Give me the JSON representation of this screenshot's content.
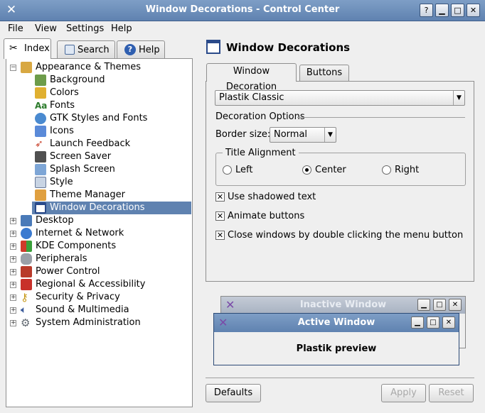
{
  "window": {
    "title": "Window Decorations - Control Center"
  },
  "menubar": {
    "file": "File",
    "view": "View",
    "settings": "Settings",
    "help": "Help"
  },
  "left_tabs": {
    "index": "Index",
    "search": "Search",
    "help": "Help"
  },
  "tree": {
    "appearance": "Appearance & Themes",
    "children": [
      "Background",
      "Colors",
      "Fonts",
      "GTK Styles and Fonts",
      "Icons",
      "Launch Feedback",
      "Screen Saver",
      "Splash Screen",
      "Style",
      "Theme Manager",
      "Window Decorations"
    ],
    "categories": [
      "Desktop",
      "Internet & Network",
      "KDE Components",
      "Peripherals",
      "Power Control",
      "Regional & Accessibility",
      "Security & Privacy",
      "Sound & Multimedia",
      "System Administration"
    ],
    "selected": "Window Decorations"
  },
  "panel": {
    "title": "Window Decorations",
    "tab_decoration": "Window Decoration",
    "tab_buttons": "Buttons",
    "theme_value": "Plastik Classic",
    "decoration_options": "Decoration Options",
    "border_size_label": "Border size:",
    "border_size_value": "Normal",
    "title_alignment": "Title Alignment",
    "align_left": "Left",
    "align_center": "Center",
    "align_right": "Right",
    "align_selected": "Center",
    "shadowed_text": "Use shadowed text",
    "animate_buttons": "Animate buttons",
    "close_double_click": "Close windows by double clicking the menu button"
  },
  "preview": {
    "inactive_title": "Inactive Window",
    "active_title": "Active Window",
    "preview_text": "Plastik preview"
  },
  "buttons": {
    "defaults": "Defaults",
    "apply": "Apply",
    "reset": "Reset"
  },
  "colors": {
    "titlebar": "#6c8dba",
    "selection": "#5f82b0"
  }
}
